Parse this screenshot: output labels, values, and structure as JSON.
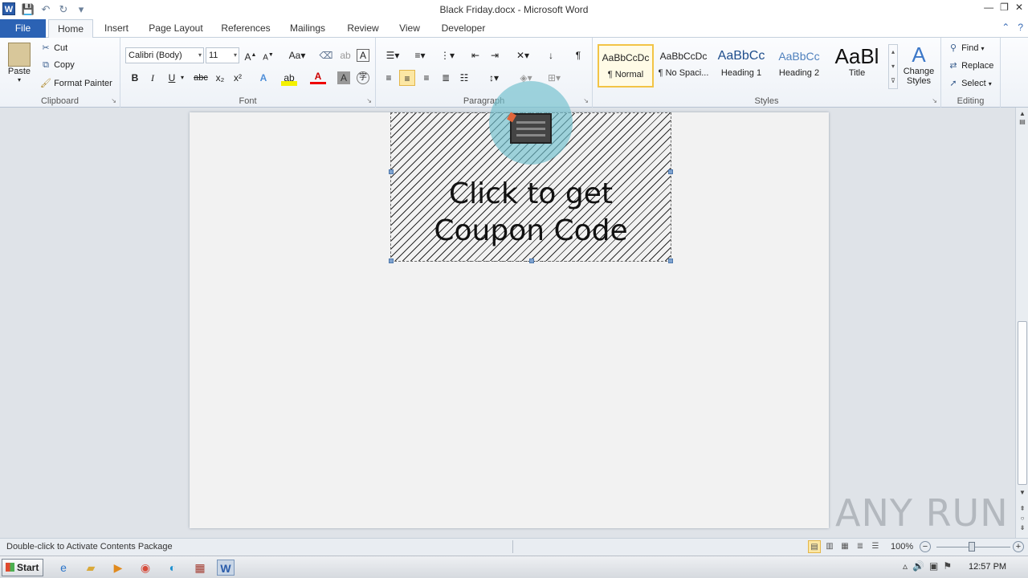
{
  "window": {
    "title": "Black Friday.docx - Microsoft Word",
    "app_icon_letter": "W"
  },
  "tabs": [
    "File",
    "Home",
    "Insert",
    "Page Layout",
    "References",
    "Mailings",
    "Review",
    "View",
    "Developer"
  ],
  "ribbon": {
    "clipboard": {
      "label": "Clipboard",
      "paste": "Paste",
      "cut": "Cut",
      "copy": "Copy",
      "format_painter": "Format Painter"
    },
    "font": {
      "label": "Font",
      "font_name": "Calibri (Body)",
      "font_size": "11",
      "bold": "B",
      "italic": "I",
      "underline": "U",
      "strikethrough": "abc",
      "subscript": "x₂",
      "superscript": "x²"
    },
    "paragraph": {
      "label": "Paragraph",
      "pilcrow": "¶"
    },
    "styles": {
      "label": "Styles",
      "items": [
        {
          "sample": "AaBbCcDc",
          "name": "¶ Normal"
        },
        {
          "sample": "AaBbCcDc",
          "name": "¶ No Spaci..."
        },
        {
          "sample": "AaBbCc",
          "name": "Heading 1"
        },
        {
          "sample": "AaBbCc",
          "name": "Heading 2"
        },
        {
          "sample": "AaBl",
          "name": "Title"
        }
      ],
      "change_styles_line1": "Change",
      "change_styles_line2": "Styles"
    },
    "editing": {
      "label": "Editing",
      "find": "Find",
      "replace": "Replace",
      "select": "Select"
    }
  },
  "document": {
    "embed_line1": "Click to get",
    "embed_line2": "Coupon Code"
  },
  "status": {
    "text": "Double-click to Activate Contents Package",
    "zoom": "100%"
  },
  "taskbar": {
    "start": "Start",
    "clock": "12:57 PM"
  },
  "watermark": "ANY RUN"
}
